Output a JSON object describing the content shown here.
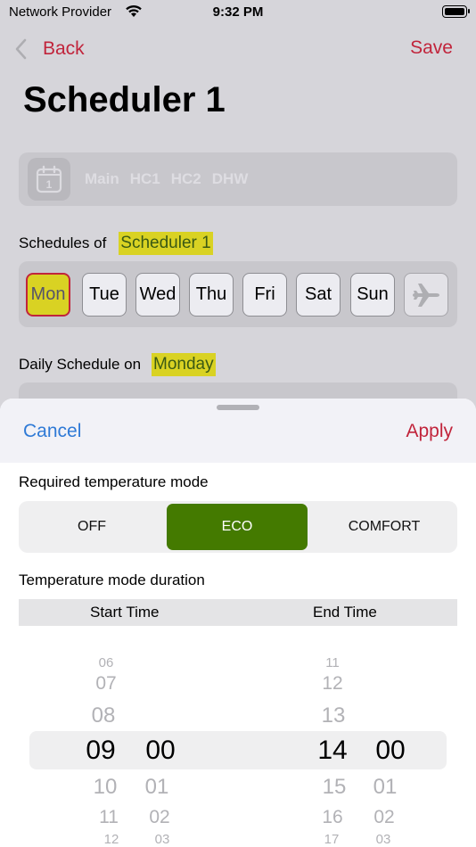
{
  "status": {
    "carrier": "Network Provider",
    "time": "9:32 PM"
  },
  "nav": {
    "back_label": "Back",
    "save_label": "Save",
    "title": "Scheduler 1"
  },
  "scheduler_tabs": {
    "calendar_day": "1",
    "items": [
      "Main",
      "HC1",
      "HC2",
      "DHW"
    ]
  },
  "schedules_of": {
    "prefix": "Schedules of",
    "name": "Scheduler 1"
  },
  "days": [
    {
      "label": "Mon",
      "active": true
    },
    {
      "label": "Tue",
      "active": false
    },
    {
      "label": "Wed",
      "active": false
    },
    {
      "label": "Thu",
      "active": false
    },
    {
      "label": "Fri",
      "active": false
    },
    {
      "label": "Sat",
      "active": false
    },
    {
      "label": "Sun",
      "active": false
    }
  ],
  "daily": {
    "prefix": "Daily Schedule on",
    "day": "Monday"
  },
  "sheet": {
    "cancel_label": "Cancel",
    "apply_label": "Apply",
    "mode_label": "Required temperature mode",
    "modes": [
      "OFF",
      "ECO",
      "COMFORT"
    ],
    "selected_mode": "ECO",
    "duration_label": "Temperature mode duration",
    "start_time_label": "Start Time",
    "end_time_label": "End Time",
    "start_hours": [
      "06",
      "07",
      "08",
      "09",
      "10",
      "11",
      "12"
    ],
    "start_minutes": [
      "00",
      "01",
      "02",
      "03"
    ],
    "end_hours": [
      "11",
      "12",
      "13",
      "14",
      "15",
      "16",
      "17"
    ],
    "end_minutes": [
      "00",
      "01",
      "02",
      "03"
    ],
    "start_selected": {
      "hour": "09",
      "minute": "00"
    },
    "end_selected": {
      "hour": "14",
      "minute": "00"
    }
  },
  "colors": {
    "accent_red": "#c1243b",
    "link_blue": "#2f7ad6",
    "highlight": "#d9d223",
    "eco_green": "#447a00"
  }
}
